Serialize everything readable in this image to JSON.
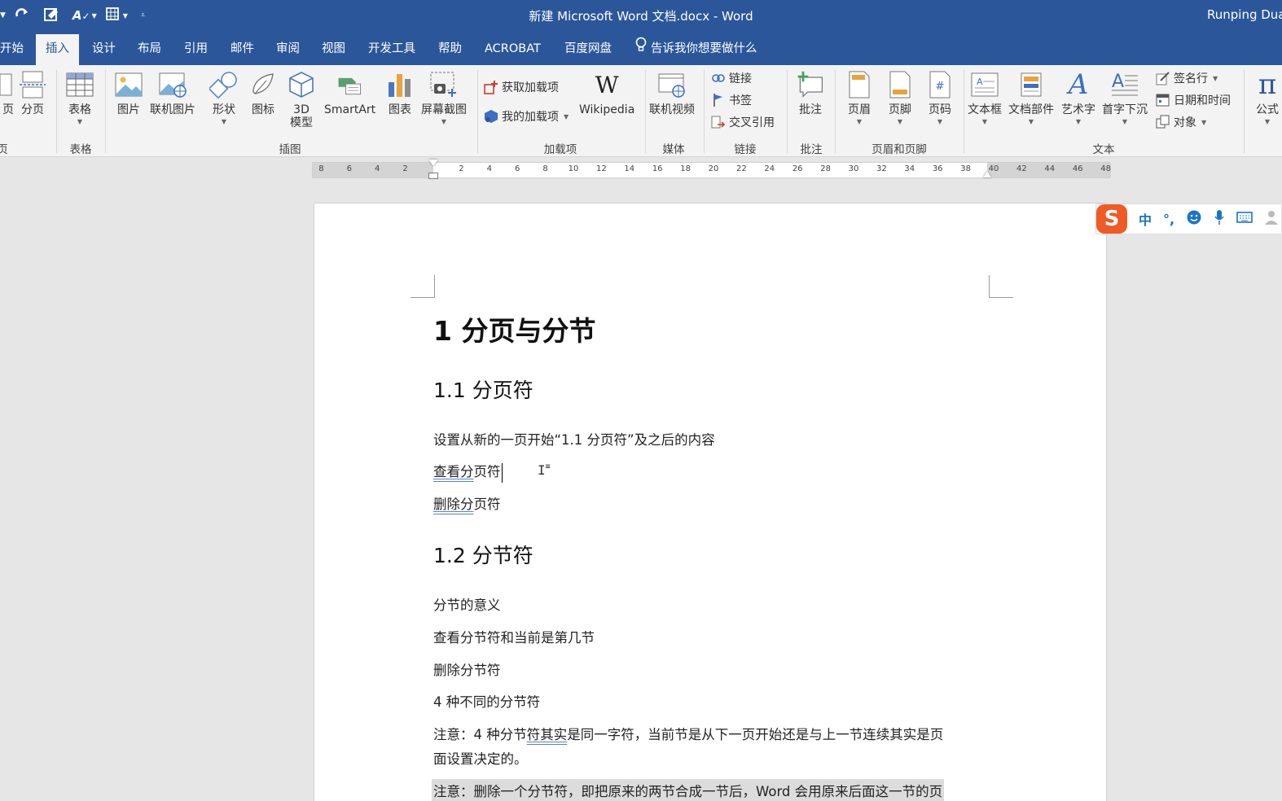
{
  "window": {
    "title": "新建 Microsoft Word 文档.docx  -  Word",
    "user": "Runping Duan"
  },
  "tabs": {
    "home": "开始",
    "insert": "插入",
    "design": "设计",
    "layout": "布局",
    "references": "引用",
    "mailings": "邮件",
    "review": "审阅",
    "view": "视图",
    "developer": "开发工具",
    "help": "帮助",
    "acrobat": "ACROBAT",
    "baidu": "百度网盘",
    "tellme": "告诉我你想要做什么"
  },
  "ribbon": {
    "pages_partial": "页",
    "page_break": "分页",
    "pages_group_partial": "页",
    "table": "表格",
    "table_group": "表格",
    "picture": "图片",
    "online_picture": "联机图片",
    "shapes": "形状",
    "icons": "图标",
    "model3d_line1": "3D",
    "model3d_line2": "模型",
    "smartart": "SmartArt",
    "chart": "图表",
    "screenshot": "屏幕截图",
    "illustrations_group": "插图",
    "get_addins": "获取加载项",
    "my_addins": "我的加载项",
    "wikipedia": "Wikipedia",
    "addins_group": "加载项",
    "online_video": "联机视频",
    "media_group": "媒体",
    "link": "链接",
    "bookmark": "书签",
    "cross_ref": "交叉引用",
    "links_group": "链接",
    "comment": "批注",
    "comments_group": "批注",
    "header": "页眉",
    "footer": "页脚",
    "page_number": "页码",
    "header_footer_group": "页眉和页脚",
    "textbox": "文本框",
    "quick_parts": "文档部件",
    "wordart": "艺术字",
    "dropcap": "首字下沉",
    "signature": "签名行",
    "datetime": "日期和时间",
    "object": "对象",
    "text_group": "文本",
    "equation": "公式"
  },
  "ruler": {
    "labels": [
      "8",
      "6",
      "4",
      "2",
      "2",
      "4",
      "6",
      "8",
      "10",
      "12",
      "14",
      "16",
      "18",
      "20",
      "22",
      "24",
      "26",
      "28",
      "30",
      "32",
      "34",
      "36",
      "38",
      "40",
      "42",
      "44",
      "46",
      "48"
    ]
  },
  "doc": {
    "h1": "1 分页与分节",
    "h2_1": "1.1 分页符",
    "p1": "设置从新的一页开始“1.1  分页符”及之后的内容",
    "p2a": "查看",
    "p2b": "分",
    "p2c": "页符",
    "p3a": "删除",
    "p3b": "分",
    "p3c": "页符",
    "h2_2": "1.2 分节符",
    "p4": "分节的意义",
    "p5": "查看分节符和当前是第几节",
    "p6": "删除分节符",
    "p7": "4 种不同的分节符",
    "p8a": "注意：4 种分节",
    "p8b": "符其实",
    "p8c": "是同一字符，当前节是从下一页开始还是与上一节连续其实是页",
    "p8d": "面设置决定的。",
    "p9": "注意：删除一个分节符，即把原来的两节合成一节后，Word 会用原来后面这一节的页"
  },
  "ime": {
    "logo": "S",
    "mode": "中",
    "punct": "°,"
  }
}
